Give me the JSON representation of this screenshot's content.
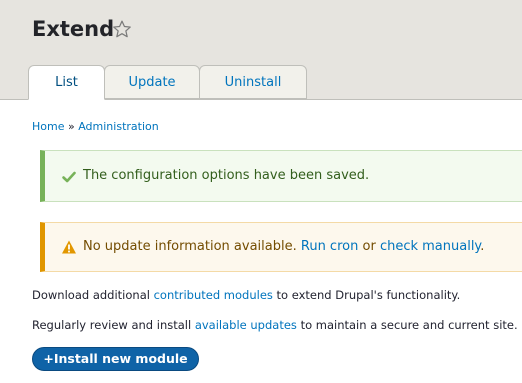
{
  "page": {
    "title": "Extend"
  },
  "tabs": [
    {
      "label": "List"
    },
    {
      "label": "Update"
    },
    {
      "label": "Uninstall"
    }
  ],
  "breadcrumb": {
    "home": "Home",
    "separator": "»",
    "administration": "Administration"
  },
  "messages": {
    "status": {
      "text": "The configuration options have been saved."
    },
    "warning": {
      "prefix": "No update information available.",
      "run_cron": "Run cron",
      "or": "or",
      "check_manually": "check manually",
      "suffix": "."
    }
  },
  "paragraphs": {
    "download": {
      "before": "Download additional",
      "link": "contributed modules",
      "after": "to extend Drupal's functionality."
    },
    "review": {
      "before": "Regularly review and install",
      "link": "available updates",
      "after": "to maintain a secure and current site."
    }
  },
  "install_button": {
    "plus": "+",
    "label": "Install new module"
  },
  "colors": {
    "link": "#0074bd",
    "status_border": "#77b259",
    "warning_border": "#e09600",
    "button": "#0f63a7"
  }
}
